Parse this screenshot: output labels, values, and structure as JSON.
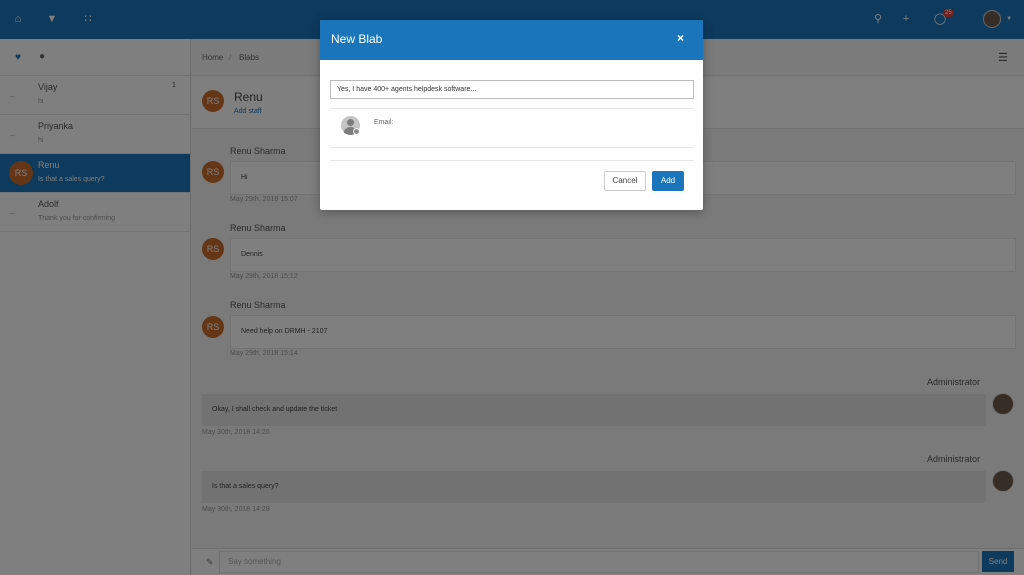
{
  "topbar": {
    "icons": [
      "home-icon",
      "download-icon",
      "grid-icon",
      "search-icon",
      "plus-icon",
      "bell-icon"
    ],
    "notification_count": "25"
  },
  "sidebar": {
    "items": [
      {
        "name": "Vijay",
        "message": "hi",
        "count": "1"
      },
      {
        "name": "Priyanka",
        "message": "hi"
      },
      {
        "name": "Renu",
        "message": "Is that a sales query?",
        "initials": "RS"
      },
      {
        "name": "Adolf",
        "message": "Thank you for confirming"
      }
    ]
  },
  "breadcrumb": {
    "home": "Home",
    "separator": "/",
    "current": "Blabs"
  },
  "chat": {
    "title": "Renu",
    "subtitle": "Add staff",
    "initials": "RS",
    "messages": [
      {
        "sender": "Renu Sharma",
        "text": "Hi",
        "time": "May 29th, 2018 15:07"
      },
      {
        "sender": "Renu Sharma",
        "text": "Dennis",
        "time": "May 29th, 2018 15:12"
      },
      {
        "sender": "Renu Sharma",
        "text": "Need help on DRMH - 2107",
        "time": "May 29th, 2018 15:14"
      },
      {
        "sender": "Administrator",
        "text": "Okay, I shall check and update the ticket",
        "time": "May 30th, 2018 14:26"
      },
      {
        "sender": "Administrator",
        "text": "Is that a sales query?",
        "time": "May 30th, 2018 14:28"
      }
    ],
    "compose_placeholder": "Say something",
    "send_label": "Send"
  },
  "modal": {
    "title": "New Blab",
    "close_label": "×",
    "input_value": "Yes, I have 400+ agents helpdesk software...",
    "email_label": "Email:",
    "cancel_label": "Cancel",
    "add_label": "Add"
  },
  "colors": {
    "accent": "#1b75bb",
    "avatar": "#c96c2c",
    "badge": "#e0463c"
  }
}
